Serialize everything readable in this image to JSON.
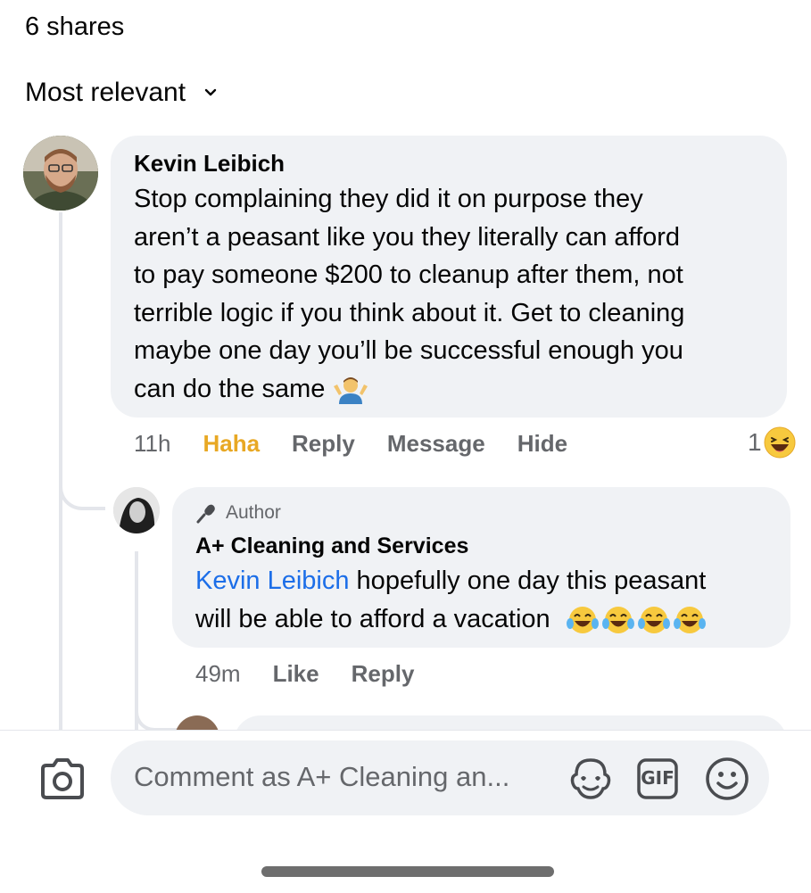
{
  "header": {
    "shares": "6 shares",
    "sort_label": "Most relevant"
  },
  "comments": [
    {
      "author": "Kevin Leibich",
      "lines": [
        "Stop complaining they did it on purpose they",
        "aren’t a peasant like you they literally can afford",
        "to pay someone $200 to cleanup after them, not",
        "terrible logic if you think about it. Get to cleaning",
        "maybe one day you’ll be successful enough you",
        "can do the same"
      ],
      "emoji": "person-shrugging-emoji",
      "time": "11h",
      "reaction_label": "Haha",
      "reply_label": "Reply",
      "message_label": "Message",
      "hide_label": "Hide",
      "reaction_count": "1",
      "reaction_icon": "haha-reaction-icon"
    },
    {
      "badge": "Author",
      "author": "A+ Cleaning and Services",
      "mention": "Kevin Leibich",
      "line1_rest": " hopefully one day this peasant",
      "line2": "will be able to afford a vacation",
      "emoji": "laughing-tears-emoji",
      "time": "49m",
      "like_label": "Like",
      "reply_label": "Reply"
    }
  ],
  "composer": {
    "placeholder": "Comment as A+ Cleaning an...",
    "gif_label": "GIF"
  },
  "colors": {
    "haha": "#e8a824",
    "mention": "#1c6ee8",
    "bubble": "#f0f2f5",
    "secondary_text": "#65676b"
  }
}
